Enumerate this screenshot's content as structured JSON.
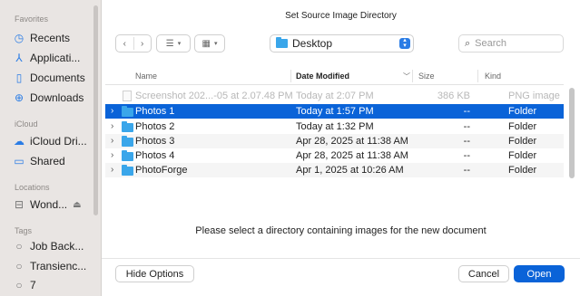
{
  "dialog": {
    "title": "Set Source Image Directory"
  },
  "sidebar": {
    "sections": [
      {
        "label": "Favorites"
      },
      {
        "label": "iCloud"
      },
      {
        "label": "Locations"
      },
      {
        "label": "Tags"
      }
    ],
    "items": [
      {
        "label": "Recents",
        "icon": "clock-icon"
      },
      {
        "label": "Applicati...",
        "icon": "applications-icon"
      },
      {
        "label": "Documents",
        "icon": "document-icon"
      },
      {
        "label": "Downloads",
        "icon": "download-icon"
      },
      {
        "label": "iCloud Dri...",
        "icon": "cloud-icon"
      },
      {
        "label": "Shared",
        "icon": "shared-folder-icon"
      },
      {
        "label": "Wond...",
        "icon": "drive-icon"
      },
      {
        "label": "Job Back...",
        "icon": "tag-icon"
      },
      {
        "label": "Transienc...",
        "icon": "tag-icon"
      },
      {
        "label": "7",
        "icon": "tag-icon"
      }
    ]
  },
  "toolbar": {
    "location": "Desktop",
    "search_placeholder": "Search"
  },
  "columns": {
    "name": "Name",
    "date": "Date Modified",
    "size": "Size",
    "kind": "Kind"
  },
  "files": [
    {
      "name": "Screenshot 202...-05 at 2.07.48 PM",
      "date": "Today at 2:07 PM",
      "size": "386 KB",
      "kind": "PNG image"
    },
    {
      "name": "Photos 1",
      "date": "Today at 1:57 PM",
      "size": "--",
      "kind": "Folder"
    },
    {
      "name": "Photos 2",
      "date": "Today at 1:32 PM",
      "size": "--",
      "kind": "Folder"
    },
    {
      "name": "Photos 3",
      "date": "Apr 28, 2025 at 11:38 AM",
      "size": "--",
      "kind": "Folder"
    },
    {
      "name": "Photos 4",
      "date": "Apr 28, 2025 at 11:38 AM",
      "size": "--",
      "kind": "Folder"
    },
    {
      "name": "PhotoForge",
      "date": "Apr 1, 2025 at 10:26 AM",
      "size": "--",
      "kind": "Folder"
    }
  ],
  "message": "Please select a directory containing images for the new document",
  "buttons": {
    "hide_options": "Hide Options",
    "cancel": "Cancel",
    "open": "Open"
  },
  "colors": {
    "accent": "#0a63d8",
    "folder": "#3aa6ea",
    "sidebar_bg": "#e9e5e3"
  }
}
